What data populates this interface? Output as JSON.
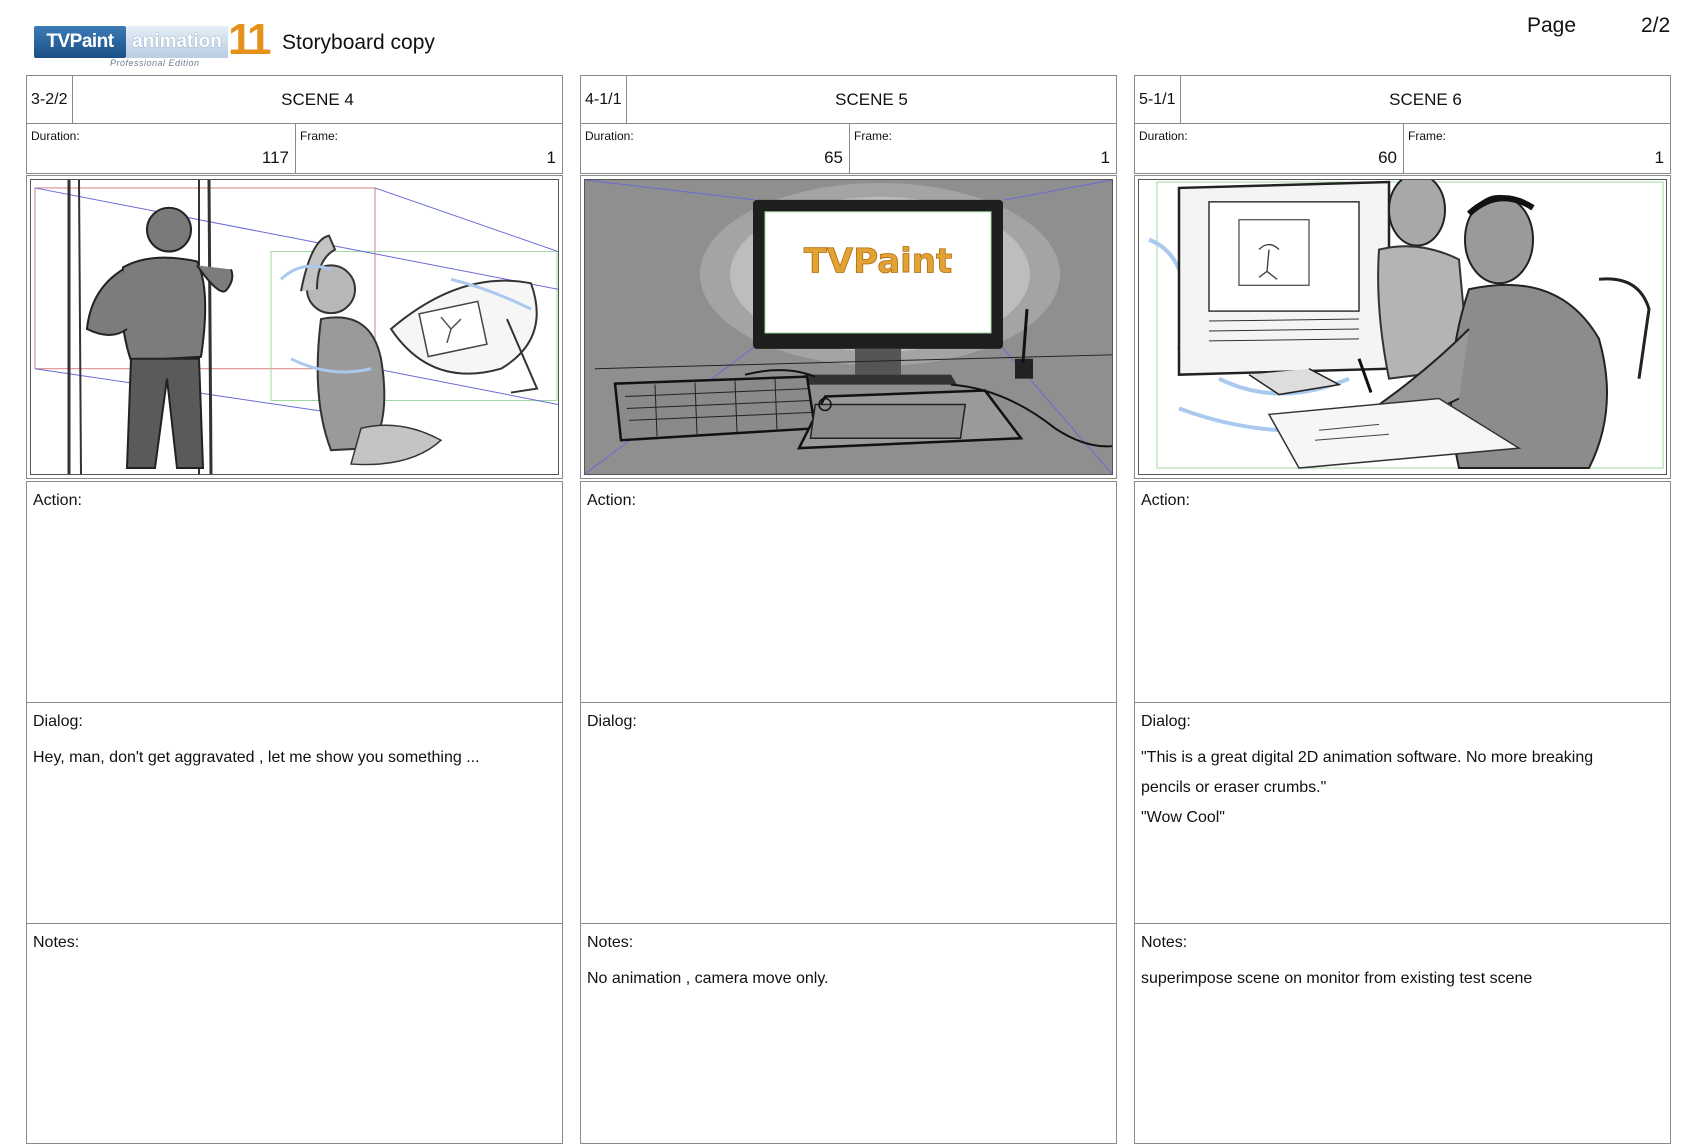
{
  "header": {
    "logo": {
      "brand": "TVPaint",
      "product": "animation",
      "version": "11",
      "edition": "Professional Edition"
    },
    "title": "Storyboard copy",
    "page_label": "Page",
    "page_number": "2/2"
  },
  "labels": {
    "duration": "Duration:",
    "frame": "Frame:",
    "action": "Action:",
    "dialog": "Dialog:",
    "notes": "Notes:"
  },
  "panels": [
    {
      "shot": "3-2/2",
      "scene": "SCENE 4",
      "duration": "117",
      "frame": "1",
      "action": "",
      "dialog": [
        "Hey, man, don't get aggravated , let me show you something ..."
      ],
      "notes": ""
    },
    {
      "shot": "4-1/1",
      "scene": "SCENE 5",
      "duration": "65",
      "frame": "1",
      "screen_logo": "TVPaint",
      "action": "",
      "dialog": [],
      "notes": "No animation , camera move only."
    },
    {
      "shot": "5-1/1",
      "scene": "SCENE 6",
      "duration": "60",
      "frame": "1",
      "action": "",
      "dialog": [
        "\"This is a great digital 2D animation software. No more breaking",
        "pencils or eraser crumbs.\"",
        "\"Wow Cool\""
      ],
      "notes": "superimpose scene on monitor from existing test scene"
    }
  ],
  "colors": {
    "logo_orange": "#e6921a",
    "logo_blue": "#2a64a0",
    "sketch_grey": "#8f8f8f",
    "guide_blue": "#6a6ad8",
    "guide_red": "#d98080",
    "guide_green": "#9fd99f"
  }
}
